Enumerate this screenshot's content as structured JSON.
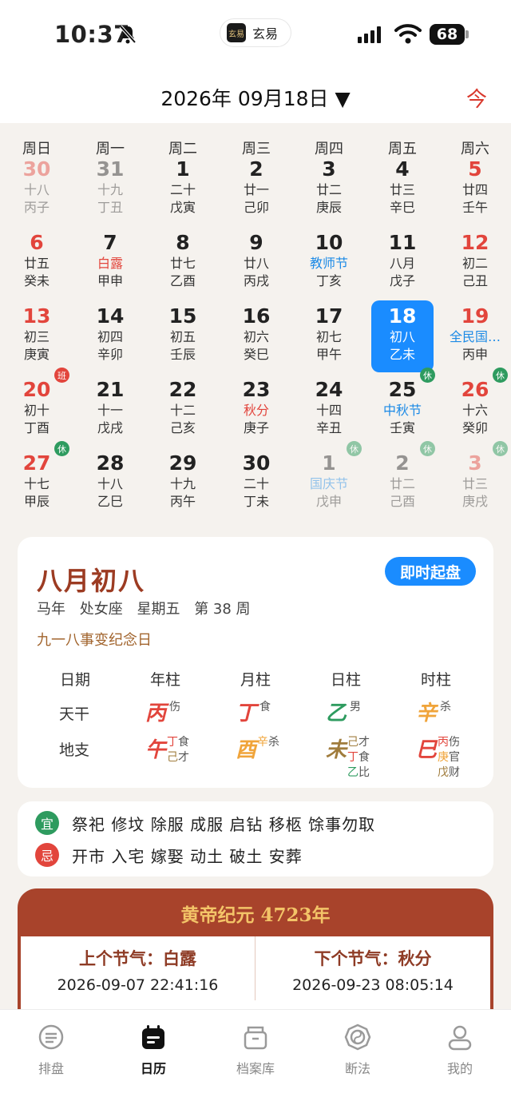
{
  "status": {
    "time": "10:37",
    "app_label": "玄易",
    "logo_text": "玄易",
    "battery": "68"
  },
  "header": {
    "date": "2026年 09月18日 ▼",
    "today_button": "今"
  },
  "week_days": [
    "周日",
    "周一",
    "周二",
    "周三",
    "周四",
    "周五",
    "周六"
  ],
  "calendar": [
    [
      {
        "d": "30",
        "l1": "十八",
        "l2": "丙子",
        "dim": true
      },
      {
        "d": "31",
        "l1": "十九",
        "l2": "丁丑",
        "dim": true
      },
      {
        "d": "1",
        "l1": "二十",
        "l2": "戊寅"
      },
      {
        "d": "2",
        "l1": "廿一",
        "l2": "己卯"
      },
      {
        "d": "3",
        "l1": "廿二",
        "l2": "庚辰"
      },
      {
        "d": "4",
        "l1": "廿三",
        "l2": "辛巳"
      },
      {
        "d": "5",
        "l1": "廿四",
        "l2": "壬午"
      }
    ],
    [
      {
        "d": "6",
        "l1": "廿五",
        "l2": "癸未"
      },
      {
        "d": "7",
        "l1": "白露",
        "l2": "甲申",
        "l1c": "red"
      },
      {
        "d": "8",
        "l1": "廿七",
        "l2": "乙酉"
      },
      {
        "d": "9",
        "l1": "廿八",
        "l2": "丙戌"
      },
      {
        "d": "10",
        "l1": "教师节",
        "l2": "丁亥",
        "l1c": "blue"
      },
      {
        "d": "11",
        "l1": "八月",
        "l2": "戊子"
      },
      {
        "d": "12",
        "l1": "初二",
        "l2": "己丑"
      }
    ],
    [
      {
        "d": "13",
        "l1": "初三",
        "l2": "庚寅"
      },
      {
        "d": "14",
        "l1": "初四",
        "l2": "辛卯"
      },
      {
        "d": "15",
        "l1": "初五",
        "l2": "壬辰"
      },
      {
        "d": "16",
        "l1": "初六",
        "l2": "癸巳"
      },
      {
        "d": "17",
        "l1": "初七",
        "l2": "甲午"
      },
      {
        "d": "18",
        "l1": "初八",
        "l2": "乙未",
        "sel": true
      },
      {
        "d": "19",
        "l1": "全民国…",
        "l2": "丙申",
        "l1c": "blue"
      }
    ],
    [
      {
        "d": "20",
        "l1": "初十",
        "l2": "丁酉",
        "badge": "班"
      },
      {
        "d": "21",
        "l1": "十一",
        "l2": "戊戌"
      },
      {
        "d": "22",
        "l1": "十二",
        "l2": "己亥"
      },
      {
        "d": "23",
        "l1": "秋分",
        "l2": "庚子",
        "l1c": "red"
      },
      {
        "d": "24",
        "l1": "十四",
        "l2": "辛丑"
      },
      {
        "d": "25",
        "l1": "中秋节",
        "l2": "壬寅",
        "l1c": "blue",
        "badge": "休"
      },
      {
        "d": "26",
        "l1": "十六",
        "l2": "癸卯",
        "badge": "休"
      }
    ],
    [
      {
        "d": "27",
        "l1": "十七",
        "l2": "甲辰",
        "badge": "休"
      },
      {
        "d": "28",
        "l1": "十八",
        "l2": "乙巳"
      },
      {
        "d": "29",
        "l1": "十九",
        "l2": "丙午"
      },
      {
        "d": "30",
        "l1": "二十",
        "l2": "丁未"
      },
      {
        "d": "1",
        "l1": "国庆节",
        "l2": "戊申",
        "l1c": "blue",
        "dim": true,
        "badge": "休"
      },
      {
        "d": "2",
        "l1": "廿二",
        "l2": "己酉",
        "dim": true,
        "badge": "休"
      },
      {
        "d": "3",
        "l1": "廿三",
        "l2": "庚戌",
        "dim": true,
        "badge": "休"
      }
    ]
  ],
  "day_info": {
    "lunar_date": "八月初八",
    "chart_button": "即时起盘",
    "details": [
      "马年",
      "处女座",
      "星期五",
      "第 38 周"
    ],
    "memorial": "九一八事变纪念日",
    "bazi_headers": [
      "日期",
      "年柱",
      "月柱",
      "日柱",
      "时柱"
    ],
    "row_tiangan": "天干",
    "row_dizhi": "地支",
    "tiangan": [
      {
        "char": "丙",
        "color": "#e2453c",
        "sup": [
          "伤"
        ]
      },
      {
        "char": "丁",
        "color": "#e2453c",
        "sup": [
          "食"
        ]
      },
      {
        "char": "乙",
        "color": "#2e9b5f",
        "sup": [
          "男"
        ]
      },
      {
        "char": "辛",
        "color": "#f0a43a",
        "sup": [
          "杀"
        ]
      }
    ],
    "dizhi": [
      {
        "char": "午",
        "color": "#e2453c",
        "sup": [
          [
            "丁",
            "#e2453c",
            "食"
          ],
          [
            "己",
            "#a07c3c",
            "才"
          ]
        ]
      },
      {
        "char": "酉",
        "color": "#f0a43a",
        "sup": [
          [
            "辛",
            "#f0a43a",
            "杀"
          ]
        ]
      },
      {
        "char": "未",
        "color": "#a07c3c",
        "sup": [
          [
            "己",
            "#a07c3c",
            "才"
          ],
          [
            "丁",
            "#e2453c",
            "食"
          ],
          [
            "乙",
            "#2e9b5f",
            "比"
          ]
        ]
      },
      {
        "char": "巳",
        "color": "#e2453c",
        "sup": [
          [
            "丙",
            "#e2453c",
            "伤"
          ],
          [
            "庚",
            "#f0a43a",
            "官"
          ],
          [
            "戊",
            "#a07c3c",
            "财"
          ]
        ]
      }
    ]
  },
  "yiji": {
    "yi_label": "宜",
    "yi": "祭祀 修坟 除服 成服 启钻 移柩 馀事勿取",
    "ji_label": "忌",
    "ji": "开市 入宅 嫁娶 动土 破土 安葬"
  },
  "era": {
    "title": "黄帝纪元 4723年",
    "prev_label": "上个节气：白露",
    "prev_time": "2026-09-07 22:41:16",
    "next_label": "下个节气：秋分",
    "next_time": "2026-09-23 08:05:14"
  },
  "tabs": [
    {
      "label": "排盘",
      "icon": "chart-plate-icon"
    },
    {
      "label": "日历",
      "icon": "calendar-icon",
      "active": true
    },
    {
      "label": "档案库",
      "icon": "archive-icon"
    },
    {
      "label": "断法",
      "icon": "bagua-icon"
    },
    {
      "label": "我的",
      "icon": "user-icon"
    }
  ],
  "colors": {
    "accent": "#1a8cff",
    "red": "#e2453c",
    "holiday_blue": "#1c8ae6",
    "rest_green": "#2e9b5f",
    "brand_brown": "#a8432b",
    "gold": "#f3c468"
  }
}
